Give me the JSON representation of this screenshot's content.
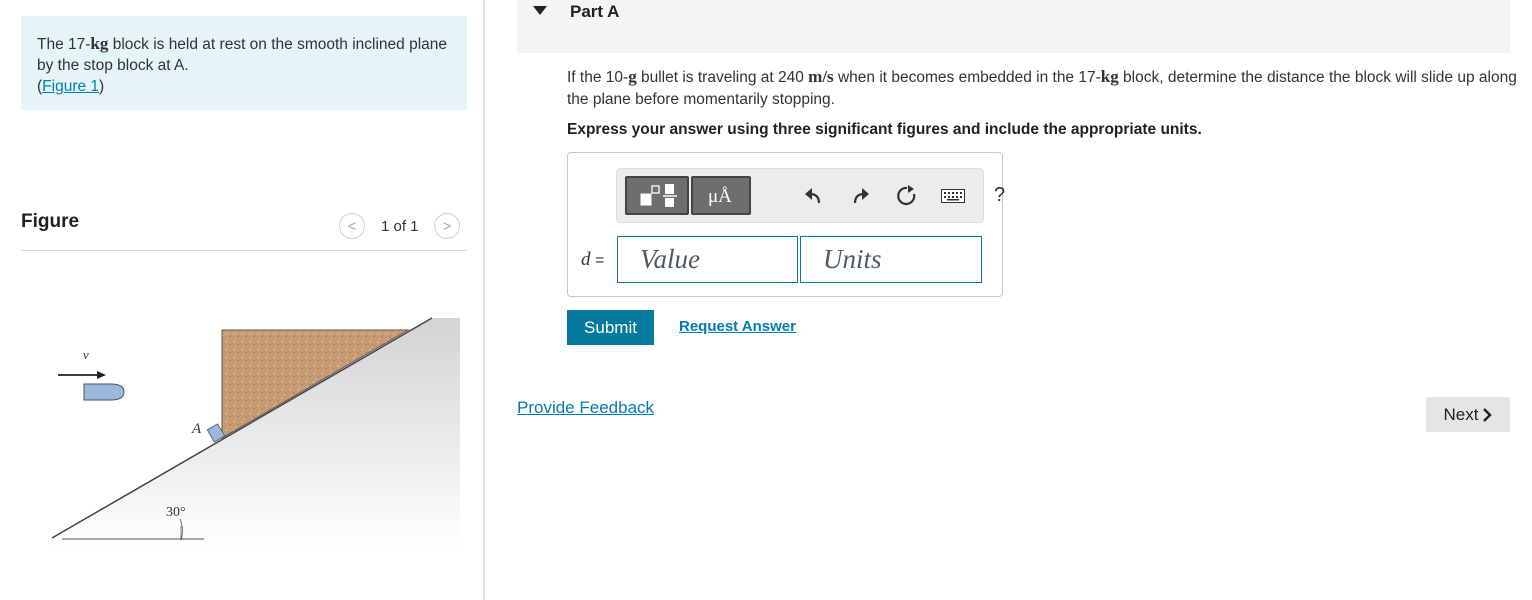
{
  "problem": {
    "text_before": "The 17-",
    "mass_unit": "kg",
    "text_after": " block is held at rest on the smooth inclined plane by the stop block at A.",
    "figure_link_open": "(",
    "figure_link": "Figure 1",
    "figure_link_close": ")"
  },
  "figure": {
    "heading": "Figure",
    "pager": "1 of 1",
    "prev_glyph": "<",
    "next_glyph": ">",
    "labels": {
      "velocity": "v",
      "stop": "A",
      "angle": "30°"
    }
  },
  "part": {
    "title": "Part A",
    "question_1": "If the 10-",
    "unit_g": "g",
    "question_2": " bullet is traveling at 240 ",
    "unit_ms": "m/s",
    "question_3": " when it becomes embedded in the 17-",
    "unit_kg": "kg",
    "question_4": " block, determine the distance the block will slide up along the plane before momentarily stopping.",
    "instruction": "Express your answer using three significant figures and include the appropriate units."
  },
  "toolbar": {
    "icons": [
      "templates-icon",
      "units-icon",
      "undo-icon",
      "redo-icon",
      "reset-icon",
      "keyboard-icon",
      "help-icon"
    ],
    "units_glyph": "μÅ",
    "help_glyph": "?"
  },
  "answer": {
    "variable": "d",
    "equals": " =",
    "value_placeholder": "Value",
    "units_placeholder": "Units"
  },
  "actions": {
    "submit": "Submit",
    "request_answer": "Request Answer",
    "feedback": "Provide Feedback",
    "next": "Next"
  },
  "colors": {
    "accent": "#037a9e",
    "problem_bg": "#e5f5f7",
    "block_fill": "#c89a72"
  }
}
